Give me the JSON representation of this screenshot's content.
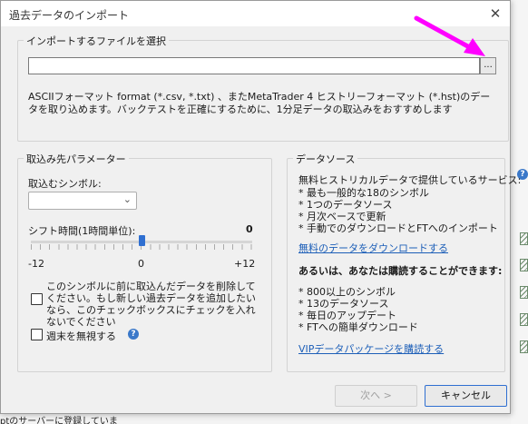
{
  "dialog": {
    "title": "過去データのインポート",
    "close_glyph": "✕"
  },
  "file_section": {
    "title": "インポートするファイルを選択",
    "file_value": "",
    "browse_label": "...",
    "description": "ASCIIフォーマット format (*.csv, *.txt) 、またMetaTrader 4 ヒストリーフォーマット (*.hst)のデータを取り込めます。バックテストを正確にするために、1分足データの取込みをおすすめします"
  },
  "import_params": {
    "title": "取込み先パラメーター",
    "symbol_label": "取込むシンボル:",
    "symbol_value": "",
    "shift_label": "シフト時間(1時間単位):",
    "shift_value": "0",
    "slider_min": "-12",
    "slider_mid": "0",
    "slider_max": "+12",
    "slider_position": 0.5,
    "delete_checkbox_label": "このシンボルに前に取込んだデータを削除してください。もし新しい過去データを追加したいなら、このチェックボックスにチェックを入れないでください",
    "delete_checked": false,
    "ignore_weekends_label": "週末を無視する",
    "ignore_weekends_checked": false
  },
  "data_source": {
    "title": "データソース",
    "free_heading": "無料ヒストリカルデータで提供しているサービス:",
    "free_items": [
      "* 最も一般的な18のシンボル",
      "* 1つのデータソース",
      "* 月次ベースで更新",
      "* 手動でのダウンロードとFTへのインポート"
    ],
    "free_link": "無料のデータをダウンロードする",
    "paid_heading": "あるいは、あなたは購読することができます:",
    "paid_items": [
      "* 800以上のシンボル",
      "* 13のデータソース",
      "* 毎日のアップデート",
      "* FTへの簡単ダウンロード"
    ],
    "paid_link": "VIPデータパッケージを購読する"
  },
  "buttons": {
    "next_label": "次へ >",
    "cancel_label": "キャンセル"
  },
  "background": {
    "bottom_text": "ptのサーバーに登録しています"
  },
  "icons": {
    "help": "?",
    "chevron": "⌄"
  },
  "colors": {
    "accent": "#2f6fd1",
    "link": "#1d5fb8",
    "annotation_arrow": "#ff00ff"
  }
}
